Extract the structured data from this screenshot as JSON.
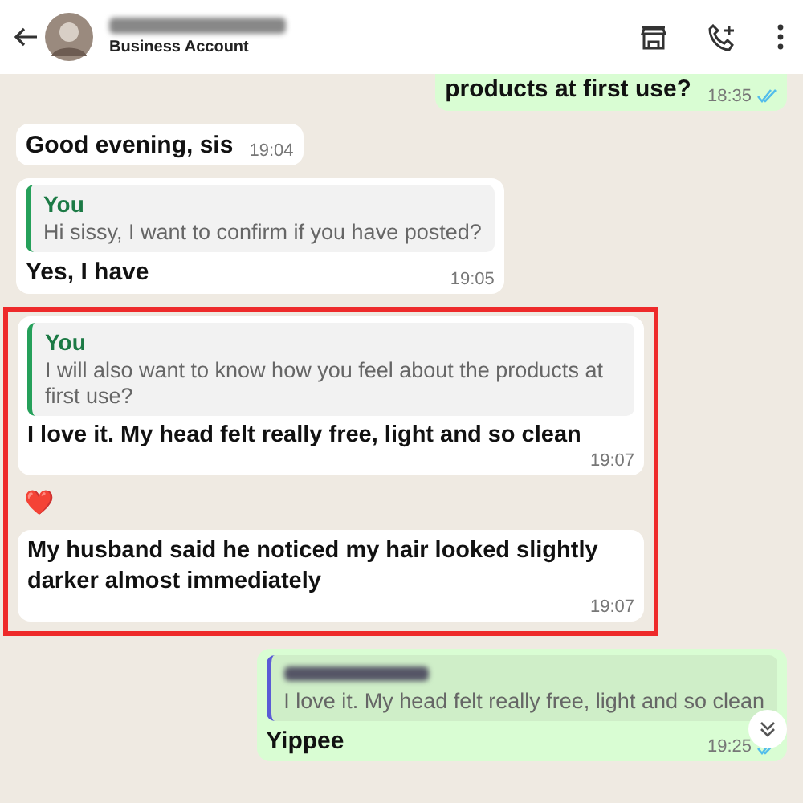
{
  "header": {
    "subtitle": "Business Account"
  },
  "messages": [
    {
      "kind": "outgoing",
      "text": "products at first use?",
      "time": "18:35",
      "read": true
    },
    {
      "kind": "incoming",
      "text": "Good evening, sis",
      "time": "19:04"
    },
    {
      "kind": "incoming",
      "quote": {
        "author": "You",
        "text": "Hi sissy, I want to confirm if you have posted?"
      },
      "text": "Yes, I have",
      "time": "19:05"
    }
  ],
  "highlighted": [
    {
      "kind": "incoming",
      "quote": {
        "author": "You",
        "text": "I will also want to know how you feel about the products at first use?"
      },
      "text": "I love it. My head felt really free, light and so clean",
      "time": "19:07",
      "reaction": "❤️"
    },
    {
      "kind": "incoming",
      "text": "My husband said he noticed my hair looked slightly darker almost immediately",
      "time": "19:07"
    }
  ],
  "after": [
    {
      "kind": "outgoing",
      "quote": {
        "author_blurred": true,
        "text": "I love it. My head felt really free, light and so clean"
      },
      "text": "Yippee",
      "time": "19:25",
      "read": true
    }
  ]
}
